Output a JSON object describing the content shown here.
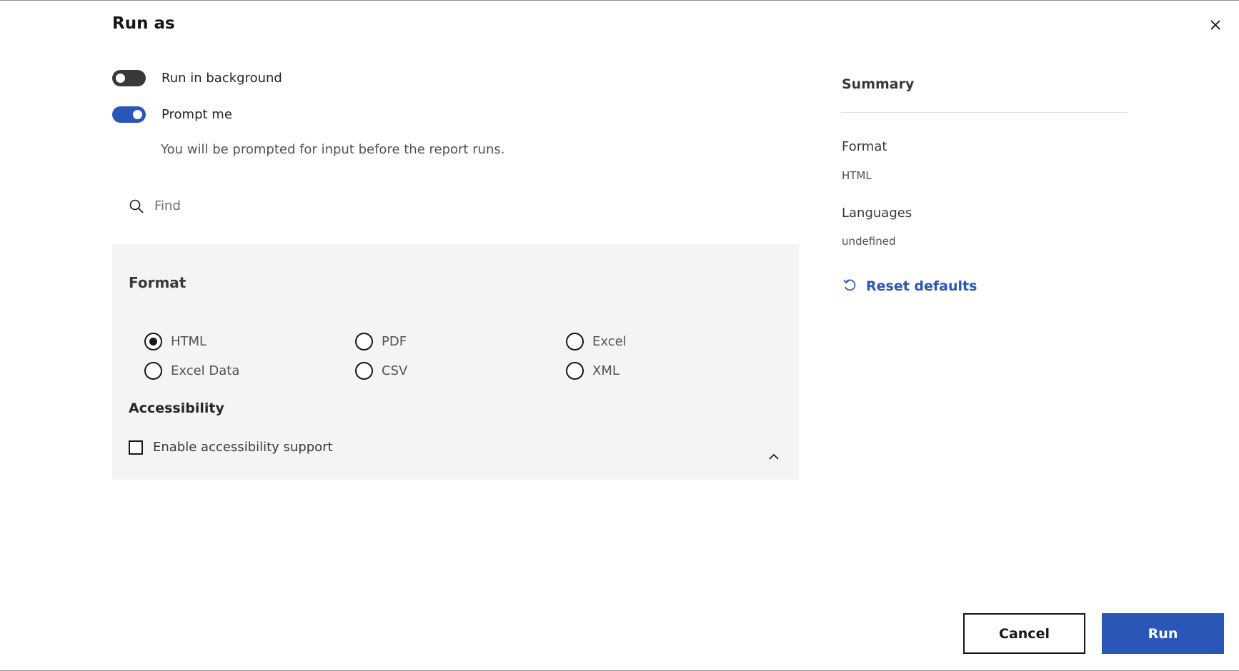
{
  "dialog": {
    "title": "Run as",
    "close_icon": "close-icon"
  },
  "options": {
    "run_in_background": {
      "label": "Run in background",
      "on": false
    },
    "prompt_me": {
      "label": "Prompt me",
      "on": true
    },
    "prompt_helper": "You will be prompted for input before the report runs."
  },
  "search": {
    "placeholder": "Find",
    "icon": "search-icon"
  },
  "format_section": {
    "title": "Format",
    "options": [
      {
        "label": "HTML",
        "selected": true
      },
      {
        "label": "PDF",
        "selected": false
      },
      {
        "label": "Excel",
        "selected": false
      },
      {
        "label": "Excel Data",
        "selected": false
      },
      {
        "label": "CSV",
        "selected": false
      },
      {
        "label": "XML",
        "selected": false
      }
    ]
  },
  "accessibility_section": {
    "title": "Accessibility",
    "checkbox_label": "Enable accessibility support",
    "checked": false
  },
  "summary": {
    "title": "Summary",
    "format_label": "Format",
    "format_value": "HTML",
    "languages_label": "Languages",
    "languages_value": "undefined",
    "reset_label": "Reset defaults"
  },
  "footer": {
    "cancel_label": "Cancel",
    "run_label": "Run"
  },
  "colors": {
    "accent": "#2a56b8",
    "panel_bg": "#f4f4f4"
  }
}
